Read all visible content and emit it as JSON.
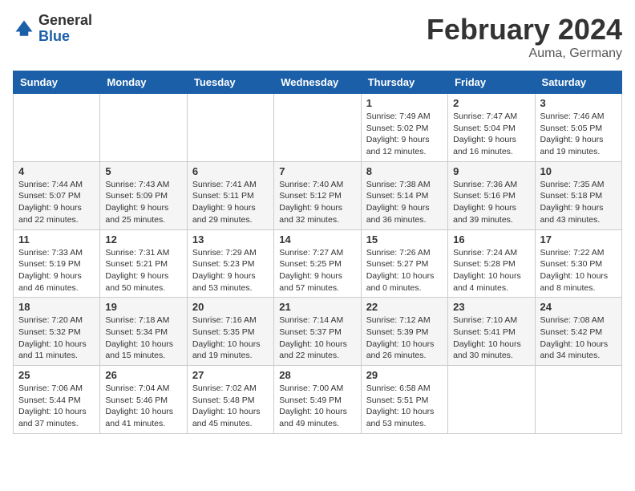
{
  "header": {
    "logo_line1": "General",
    "logo_line2": "Blue",
    "title": "February 2024",
    "subtitle": "Auma, Germany"
  },
  "columns": [
    "Sunday",
    "Monday",
    "Tuesday",
    "Wednesday",
    "Thursday",
    "Friday",
    "Saturday"
  ],
  "weeks": [
    [
      {
        "day": "",
        "info": ""
      },
      {
        "day": "",
        "info": ""
      },
      {
        "day": "",
        "info": ""
      },
      {
        "day": "",
        "info": ""
      },
      {
        "day": "1",
        "info": "Sunrise: 7:49 AM\nSunset: 5:02 PM\nDaylight: 9 hours\nand 12 minutes."
      },
      {
        "day": "2",
        "info": "Sunrise: 7:47 AM\nSunset: 5:04 PM\nDaylight: 9 hours\nand 16 minutes."
      },
      {
        "day": "3",
        "info": "Sunrise: 7:46 AM\nSunset: 5:05 PM\nDaylight: 9 hours\nand 19 minutes."
      }
    ],
    [
      {
        "day": "4",
        "info": "Sunrise: 7:44 AM\nSunset: 5:07 PM\nDaylight: 9 hours\nand 22 minutes."
      },
      {
        "day": "5",
        "info": "Sunrise: 7:43 AM\nSunset: 5:09 PM\nDaylight: 9 hours\nand 25 minutes."
      },
      {
        "day": "6",
        "info": "Sunrise: 7:41 AM\nSunset: 5:11 PM\nDaylight: 9 hours\nand 29 minutes."
      },
      {
        "day": "7",
        "info": "Sunrise: 7:40 AM\nSunset: 5:12 PM\nDaylight: 9 hours\nand 32 minutes."
      },
      {
        "day": "8",
        "info": "Sunrise: 7:38 AM\nSunset: 5:14 PM\nDaylight: 9 hours\nand 36 minutes."
      },
      {
        "day": "9",
        "info": "Sunrise: 7:36 AM\nSunset: 5:16 PM\nDaylight: 9 hours\nand 39 minutes."
      },
      {
        "day": "10",
        "info": "Sunrise: 7:35 AM\nSunset: 5:18 PM\nDaylight: 9 hours\nand 43 minutes."
      }
    ],
    [
      {
        "day": "11",
        "info": "Sunrise: 7:33 AM\nSunset: 5:19 PM\nDaylight: 9 hours\nand 46 minutes."
      },
      {
        "day": "12",
        "info": "Sunrise: 7:31 AM\nSunset: 5:21 PM\nDaylight: 9 hours\nand 50 minutes."
      },
      {
        "day": "13",
        "info": "Sunrise: 7:29 AM\nSunset: 5:23 PM\nDaylight: 9 hours\nand 53 minutes."
      },
      {
        "day": "14",
        "info": "Sunrise: 7:27 AM\nSunset: 5:25 PM\nDaylight: 9 hours\nand 57 minutes."
      },
      {
        "day": "15",
        "info": "Sunrise: 7:26 AM\nSunset: 5:27 PM\nDaylight: 10 hours\nand 0 minutes."
      },
      {
        "day": "16",
        "info": "Sunrise: 7:24 AM\nSunset: 5:28 PM\nDaylight: 10 hours\nand 4 minutes."
      },
      {
        "day": "17",
        "info": "Sunrise: 7:22 AM\nSunset: 5:30 PM\nDaylight: 10 hours\nand 8 minutes."
      }
    ],
    [
      {
        "day": "18",
        "info": "Sunrise: 7:20 AM\nSunset: 5:32 PM\nDaylight: 10 hours\nand 11 minutes."
      },
      {
        "day": "19",
        "info": "Sunrise: 7:18 AM\nSunset: 5:34 PM\nDaylight: 10 hours\nand 15 minutes."
      },
      {
        "day": "20",
        "info": "Sunrise: 7:16 AM\nSunset: 5:35 PM\nDaylight: 10 hours\nand 19 minutes."
      },
      {
        "day": "21",
        "info": "Sunrise: 7:14 AM\nSunset: 5:37 PM\nDaylight: 10 hours\nand 22 minutes."
      },
      {
        "day": "22",
        "info": "Sunrise: 7:12 AM\nSunset: 5:39 PM\nDaylight: 10 hours\nand 26 minutes."
      },
      {
        "day": "23",
        "info": "Sunrise: 7:10 AM\nSunset: 5:41 PM\nDaylight: 10 hours\nand 30 minutes."
      },
      {
        "day": "24",
        "info": "Sunrise: 7:08 AM\nSunset: 5:42 PM\nDaylight: 10 hours\nand 34 minutes."
      }
    ],
    [
      {
        "day": "25",
        "info": "Sunrise: 7:06 AM\nSunset: 5:44 PM\nDaylight: 10 hours\nand 37 minutes."
      },
      {
        "day": "26",
        "info": "Sunrise: 7:04 AM\nSunset: 5:46 PM\nDaylight: 10 hours\nand 41 minutes."
      },
      {
        "day": "27",
        "info": "Sunrise: 7:02 AM\nSunset: 5:48 PM\nDaylight: 10 hours\nand 45 minutes."
      },
      {
        "day": "28",
        "info": "Sunrise: 7:00 AM\nSunset: 5:49 PM\nDaylight: 10 hours\nand 49 minutes."
      },
      {
        "day": "29",
        "info": "Sunrise: 6:58 AM\nSunset: 5:51 PM\nDaylight: 10 hours\nand 53 minutes."
      },
      {
        "day": "",
        "info": ""
      },
      {
        "day": "",
        "info": ""
      }
    ]
  ]
}
